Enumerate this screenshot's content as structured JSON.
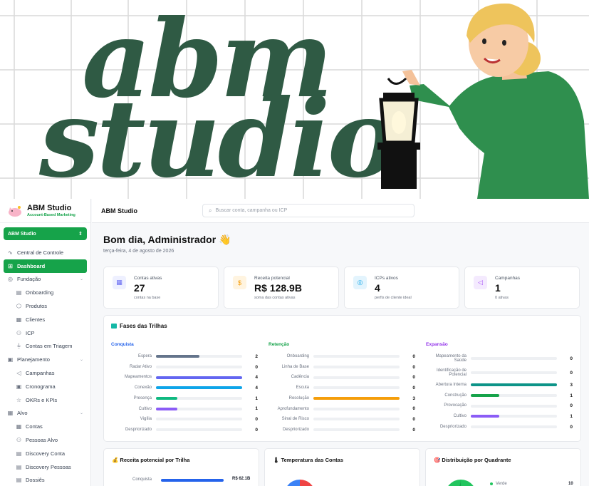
{
  "banner": {
    "line1": "abm",
    "line2": "studio"
  },
  "sidebar": {
    "brand_title": "ABM Studio",
    "brand_sub": "Account-Based Marketing",
    "workspace": "ABM Studio",
    "items": [
      {
        "label": "Central de Controle",
        "icon": "activity-icon",
        "type": "top"
      },
      {
        "label": "Dashboard",
        "icon": "grid-icon",
        "type": "active"
      },
      {
        "label": "Fundação",
        "icon": "globe-icon",
        "type": "group"
      },
      {
        "label": "Onboarding",
        "icon": "doc-icon",
        "type": "sub"
      },
      {
        "label": "Produtos",
        "icon": "box-icon",
        "type": "sub"
      },
      {
        "label": "Clientes",
        "icon": "building-icon",
        "type": "sub"
      },
      {
        "label": "ICP",
        "icon": "users-icon",
        "type": "sub"
      },
      {
        "label": "Contas em Triagem",
        "icon": "filter-icon",
        "type": "sub"
      },
      {
        "label": "Planejamento",
        "icon": "calendar-icon",
        "type": "group"
      },
      {
        "label": "Campanhas",
        "icon": "megaphone-icon",
        "type": "sub"
      },
      {
        "label": "Cronograma",
        "icon": "calendar-icon",
        "type": "sub"
      },
      {
        "label": "OKRs e KPIs",
        "icon": "star-icon",
        "type": "sub"
      },
      {
        "label": "Alvo",
        "icon": "building-icon",
        "type": "group"
      },
      {
        "label": "Contas",
        "icon": "building-icon",
        "type": "sub"
      },
      {
        "label": "Pessoas Alvo",
        "icon": "people-icon",
        "type": "sub"
      },
      {
        "label": "Discovery Conta",
        "icon": "doc-icon",
        "type": "sub"
      },
      {
        "label": "Discovery Pessoas",
        "icon": "doc-icon",
        "type": "sub"
      },
      {
        "label": "Dossiês",
        "icon": "doc-icon",
        "type": "sub"
      }
    ]
  },
  "topbar": {
    "title": "ABM Studio",
    "search_placeholder": "Buscar conta, campanha ou ICP"
  },
  "main": {
    "greeting": "Bom dia, Administrador 👋",
    "date": "terça-feira, 4 de agosto de 2026",
    "stats": [
      {
        "label": "Contas ativas",
        "value": "27",
        "sub": "contas na base",
        "icon": "building-icon",
        "color": "#6366f1",
        "bg": "#eef0ff"
      },
      {
        "label": "Receita potencial",
        "value": "R$ 128.9B",
        "sub": "soma das contas ativas",
        "icon": "dollar-icon",
        "color": "#f59e0b",
        "bg": "#fff4e0"
      },
      {
        "label": "ICPs ativos",
        "value": "4",
        "sub": "perfis de cliente ideal",
        "icon": "target-icon",
        "color": "#0ea5e9",
        "bg": "#e3f4fd"
      },
      {
        "label": "Campanhas",
        "value": "1",
        "sub": "0 ativas",
        "icon": "megaphone-icon",
        "color": "#a855f7",
        "bg": "#f4eafe"
      }
    ],
    "phases_title": "Fases das Trilhas",
    "columns": [
      {
        "name": "Conquista",
        "color": "#2563eb",
        "max": 4,
        "rows": [
          {
            "label": "Espera",
            "value": 2,
            "color": "#64748b"
          },
          {
            "label": "Radar Ativo",
            "value": 0,
            "color": "#94a3b8"
          },
          {
            "label": "Mapeamentos",
            "value": 4,
            "color": "#6366f1"
          },
          {
            "label": "Conexão",
            "value": 4,
            "color": "#0ea5e9"
          },
          {
            "label": "Presença",
            "value": 1,
            "color": "#10b981"
          },
          {
            "label": "Cultivo",
            "value": 1,
            "color": "#8b5cf6"
          },
          {
            "label": "Vigília",
            "value": 0,
            "color": "#94a3b8"
          },
          {
            "label": "Despriorizado",
            "value": 0,
            "color": "#94a3b8"
          }
        ]
      },
      {
        "name": "Retenção",
        "color": "#16a34a",
        "max": 3,
        "rows": [
          {
            "label": "Onboarding",
            "value": 0,
            "color": "#94a3b8"
          },
          {
            "label": "Linha de Base",
            "value": 0,
            "color": "#94a3b8"
          },
          {
            "label": "Cadência",
            "value": 0,
            "color": "#94a3b8"
          },
          {
            "label": "Escuta",
            "value": 0,
            "color": "#94a3b8"
          },
          {
            "label": "Resolução",
            "value": 3,
            "color": "#f59e0b"
          },
          {
            "label": "Aprofundamento",
            "value": 0,
            "color": "#94a3b8"
          },
          {
            "label": "Sinal de Risco",
            "value": 0,
            "color": "#94a3b8"
          },
          {
            "label": "Despriorizado",
            "value": 0,
            "color": "#94a3b8"
          }
        ]
      },
      {
        "name": "Expansão",
        "color": "#9333ea",
        "max": 3,
        "rows": [
          {
            "label": "Mapeamento da Saúde",
            "value": 0,
            "color": "#94a3b8"
          },
          {
            "label": "Identificação de Potencial",
            "value": 0,
            "color": "#94a3b8"
          },
          {
            "label": "Abertura Interna",
            "value": 3,
            "color": "#0d9488"
          },
          {
            "label": "Construção",
            "value": 1,
            "color": "#16a34a"
          },
          {
            "label": "Provocação",
            "value": 0,
            "color": "#94a3b8"
          },
          {
            "label": "Cultivo",
            "value": 1,
            "color": "#8b5cf6"
          },
          {
            "label": "Despriorizado",
            "value": 0,
            "color": "#94a3b8"
          }
        ]
      }
    ],
    "cards": [
      {
        "title": "💰 Receita potencial por Trilha",
        "first_label": "Conquista",
        "first_value": "R$ 62.1B"
      },
      {
        "title": "🌡 Temperatura das Contas"
      },
      {
        "title": "🎯 Distribuição por Quadrante",
        "legend_label": "Verde",
        "legend_value": "10"
      }
    ]
  }
}
